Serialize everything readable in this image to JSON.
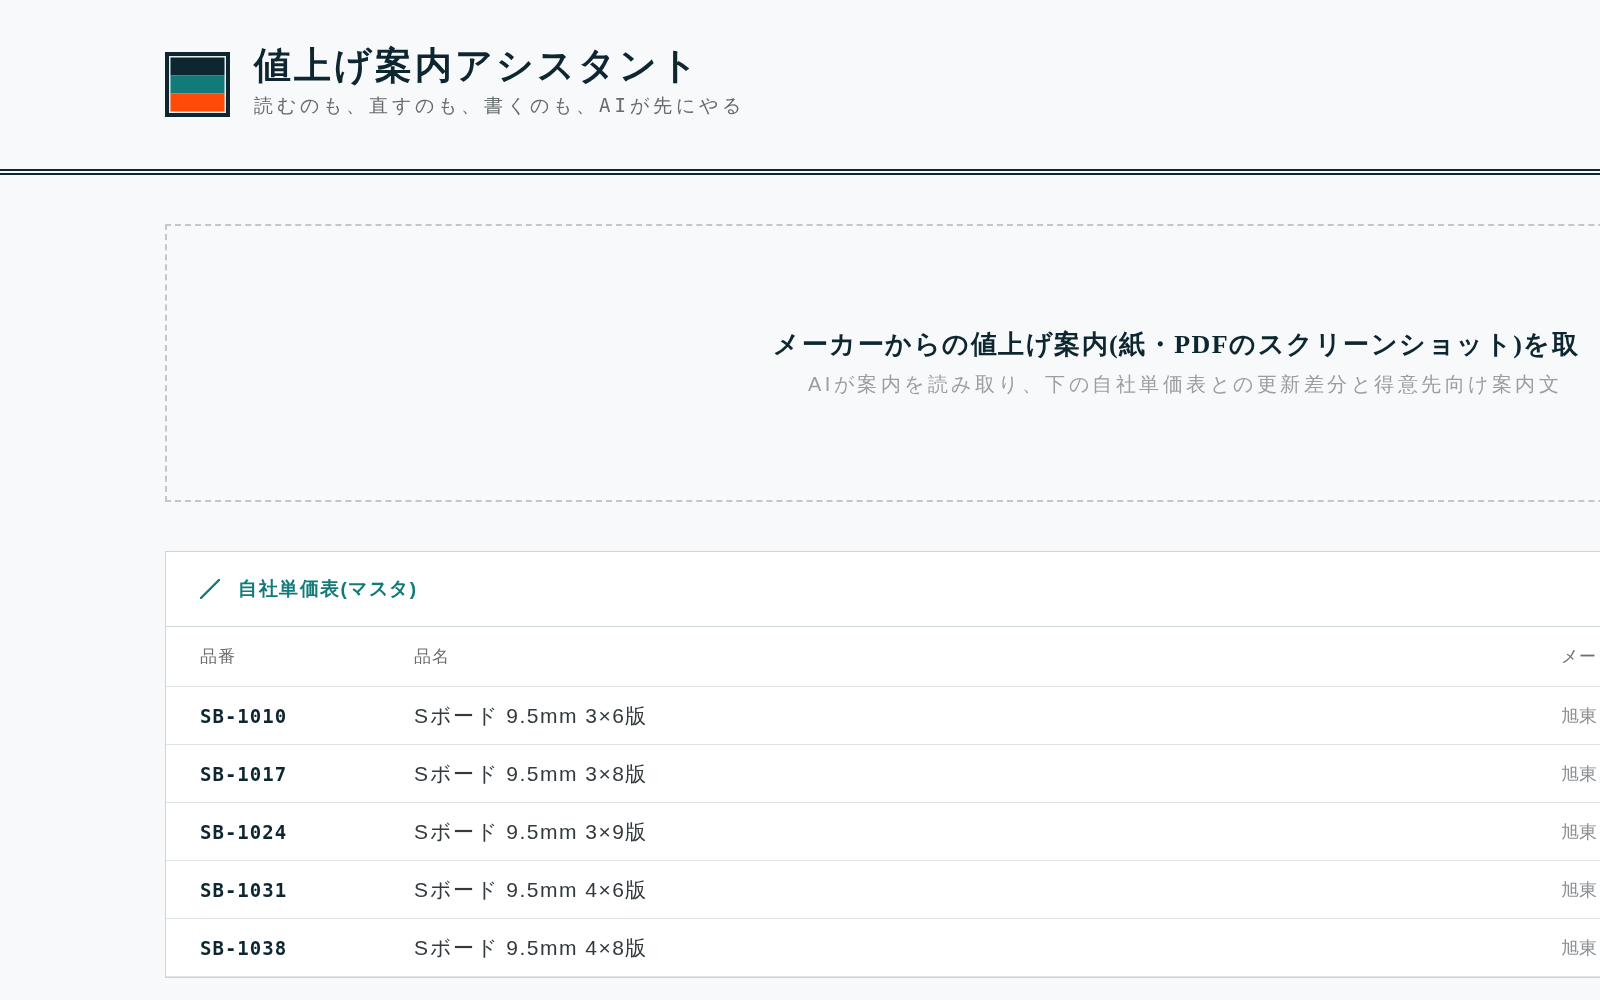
{
  "header": {
    "title": "値上げ案内アシスタント",
    "tagline": "読むのも、直すのも、書くのも、AIが先にやる"
  },
  "upload": {
    "title": "メーカーからの値上げ案内(紙・PDFのスクリーンショット)を取",
    "hint": "AIが案内を読み取り、下の自社単価表との更新差分と得意先向け案内文"
  },
  "master_table": {
    "title": "自社単価表(マスタ)",
    "columns": [
      "品番",
      "品名",
      "メー"
    ],
    "rows": [
      {
        "part_no": "SB-1010",
        "name": "Sボード 9.5mm 3×6版",
        "maker": "旭東"
      },
      {
        "part_no": "SB-1017",
        "name": "Sボード 9.5mm 3×8版",
        "maker": "旭東"
      },
      {
        "part_no": "SB-1024",
        "name": "Sボード 9.5mm 3×9版",
        "maker": "旭東"
      },
      {
        "part_no": "SB-1031",
        "name": "Sボード 9.5mm 4×6版",
        "maker": "旭東"
      },
      {
        "part_no": "SB-1038",
        "name": "Sボード 9.5mm 4×8版",
        "maker": "旭東"
      }
    ]
  }
}
